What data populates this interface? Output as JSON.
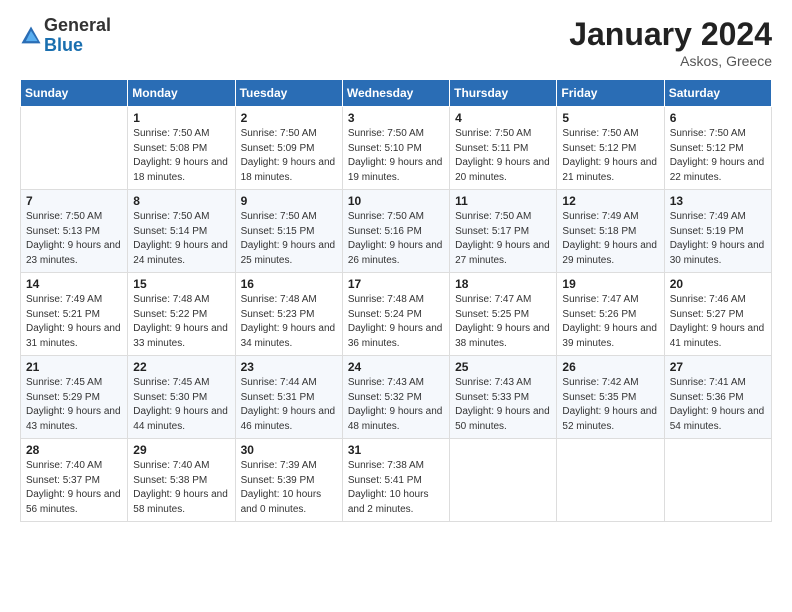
{
  "logo": {
    "general": "General",
    "blue": "Blue"
  },
  "header": {
    "month_title": "January 2024",
    "location": "Askos, Greece"
  },
  "weekdays": [
    "Sunday",
    "Monday",
    "Tuesday",
    "Wednesday",
    "Thursday",
    "Friday",
    "Saturday"
  ],
  "weeks": [
    [
      {
        "day": "",
        "sunrise": "",
        "sunset": "",
        "daylight": ""
      },
      {
        "day": "1",
        "sunrise": "Sunrise: 7:50 AM",
        "sunset": "Sunset: 5:08 PM",
        "daylight": "Daylight: 9 hours and 18 minutes."
      },
      {
        "day": "2",
        "sunrise": "Sunrise: 7:50 AM",
        "sunset": "Sunset: 5:09 PM",
        "daylight": "Daylight: 9 hours and 18 minutes."
      },
      {
        "day": "3",
        "sunrise": "Sunrise: 7:50 AM",
        "sunset": "Sunset: 5:10 PM",
        "daylight": "Daylight: 9 hours and 19 minutes."
      },
      {
        "day": "4",
        "sunrise": "Sunrise: 7:50 AM",
        "sunset": "Sunset: 5:11 PM",
        "daylight": "Daylight: 9 hours and 20 minutes."
      },
      {
        "day": "5",
        "sunrise": "Sunrise: 7:50 AM",
        "sunset": "Sunset: 5:12 PM",
        "daylight": "Daylight: 9 hours and 21 minutes."
      },
      {
        "day": "6",
        "sunrise": "Sunrise: 7:50 AM",
        "sunset": "Sunset: 5:12 PM",
        "daylight": "Daylight: 9 hours and 22 minutes."
      }
    ],
    [
      {
        "day": "7",
        "sunrise": "Sunrise: 7:50 AM",
        "sunset": "Sunset: 5:13 PM",
        "daylight": "Daylight: 9 hours and 23 minutes."
      },
      {
        "day": "8",
        "sunrise": "Sunrise: 7:50 AM",
        "sunset": "Sunset: 5:14 PM",
        "daylight": "Daylight: 9 hours and 24 minutes."
      },
      {
        "day": "9",
        "sunrise": "Sunrise: 7:50 AM",
        "sunset": "Sunset: 5:15 PM",
        "daylight": "Daylight: 9 hours and 25 minutes."
      },
      {
        "day": "10",
        "sunrise": "Sunrise: 7:50 AM",
        "sunset": "Sunset: 5:16 PM",
        "daylight": "Daylight: 9 hours and 26 minutes."
      },
      {
        "day": "11",
        "sunrise": "Sunrise: 7:50 AM",
        "sunset": "Sunset: 5:17 PM",
        "daylight": "Daylight: 9 hours and 27 minutes."
      },
      {
        "day": "12",
        "sunrise": "Sunrise: 7:49 AM",
        "sunset": "Sunset: 5:18 PM",
        "daylight": "Daylight: 9 hours and 29 minutes."
      },
      {
        "day": "13",
        "sunrise": "Sunrise: 7:49 AM",
        "sunset": "Sunset: 5:19 PM",
        "daylight": "Daylight: 9 hours and 30 minutes."
      }
    ],
    [
      {
        "day": "14",
        "sunrise": "Sunrise: 7:49 AM",
        "sunset": "Sunset: 5:21 PM",
        "daylight": "Daylight: 9 hours and 31 minutes."
      },
      {
        "day": "15",
        "sunrise": "Sunrise: 7:48 AM",
        "sunset": "Sunset: 5:22 PM",
        "daylight": "Daylight: 9 hours and 33 minutes."
      },
      {
        "day": "16",
        "sunrise": "Sunrise: 7:48 AM",
        "sunset": "Sunset: 5:23 PM",
        "daylight": "Daylight: 9 hours and 34 minutes."
      },
      {
        "day": "17",
        "sunrise": "Sunrise: 7:48 AM",
        "sunset": "Sunset: 5:24 PM",
        "daylight": "Daylight: 9 hours and 36 minutes."
      },
      {
        "day": "18",
        "sunrise": "Sunrise: 7:47 AM",
        "sunset": "Sunset: 5:25 PM",
        "daylight": "Daylight: 9 hours and 38 minutes."
      },
      {
        "day": "19",
        "sunrise": "Sunrise: 7:47 AM",
        "sunset": "Sunset: 5:26 PM",
        "daylight": "Daylight: 9 hours and 39 minutes."
      },
      {
        "day": "20",
        "sunrise": "Sunrise: 7:46 AM",
        "sunset": "Sunset: 5:27 PM",
        "daylight": "Daylight: 9 hours and 41 minutes."
      }
    ],
    [
      {
        "day": "21",
        "sunrise": "Sunrise: 7:45 AM",
        "sunset": "Sunset: 5:29 PM",
        "daylight": "Daylight: 9 hours and 43 minutes."
      },
      {
        "day": "22",
        "sunrise": "Sunrise: 7:45 AM",
        "sunset": "Sunset: 5:30 PM",
        "daylight": "Daylight: 9 hours and 44 minutes."
      },
      {
        "day": "23",
        "sunrise": "Sunrise: 7:44 AM",
        "sunset": "Sunset: 5:31 PM",
        "daylight": "Daylight: 9 hours and 46 minutes."
      },
      {
        "day": "24",
        "sunrise": "Sunrise: 7:43 AM",
        "sunset": "Sunset: 5:32 PM",
        "daylight": "Daylight: 9 hours and 48 minutes."
      },
      {
        "day": "25",
        "sunrise": "Sunrise: 7:43 AM",
        "sunset": "Sunset: 5:33 PM",
        "daylight": "Daylight: 9 hours and 50 minutes."
      },
      {
        "day": "26",
        "sunrise": "Sunrise: 7:42 AM",
        "sunset": "Sunset: 5:35 PM",
        "daylight": "Daylight: 9 hours and 52 minutes."
      },
      {
        "day": "27",
        "sunrise": "Sunrise: 7:41 AM",
        "sunset": "Sunset: 5:36 PM",
        "daylight": "Daylight: 9 hours and 54 minutes."
      }
    ],
    [
      {
        "day": "28",
        "sunrise": "Sunrise: 7:40 AM",
        "sunset": "Sunset: 5:37 PM",
        "daylight": "Daylight: 9 hours and 56 minutes."
      },
      {
        "day": "29",
        "sunrise": "Sunrise: 7:40 AM",
        "sunset": "Sunset: 5:38 PM",
        "daylight": "Daylight: 9 hours and 58 minutes."
      },
      {
        "day": "30",
        "sunrise": "Sunrise: 7:39 AM",
        "sunset": "Sunset: 5:39 PM",
        "daylight": "Daylight: 10 hours and 0 minutes."
      },
      {
        "day": "31",
        "sunrise": "Sunrise: 7:38 AM",
        "sunset": "Sunset: 5:41 PM",
        "daylight": "Daylight: 10 hours and 2 minutes."
      },
      {
        "day": "",
        "sunrise": "",
        "sunset": "",
        "daylight": ""
      },
      {
        "day": "",
        "sunrise": "",
        "sunset": "",
        "daylight": ""
      },
      {
        "day": "",
        "sunrise": "",
        "sunset": "",
        "daylight": ""
      }
    ]
  ]
}
